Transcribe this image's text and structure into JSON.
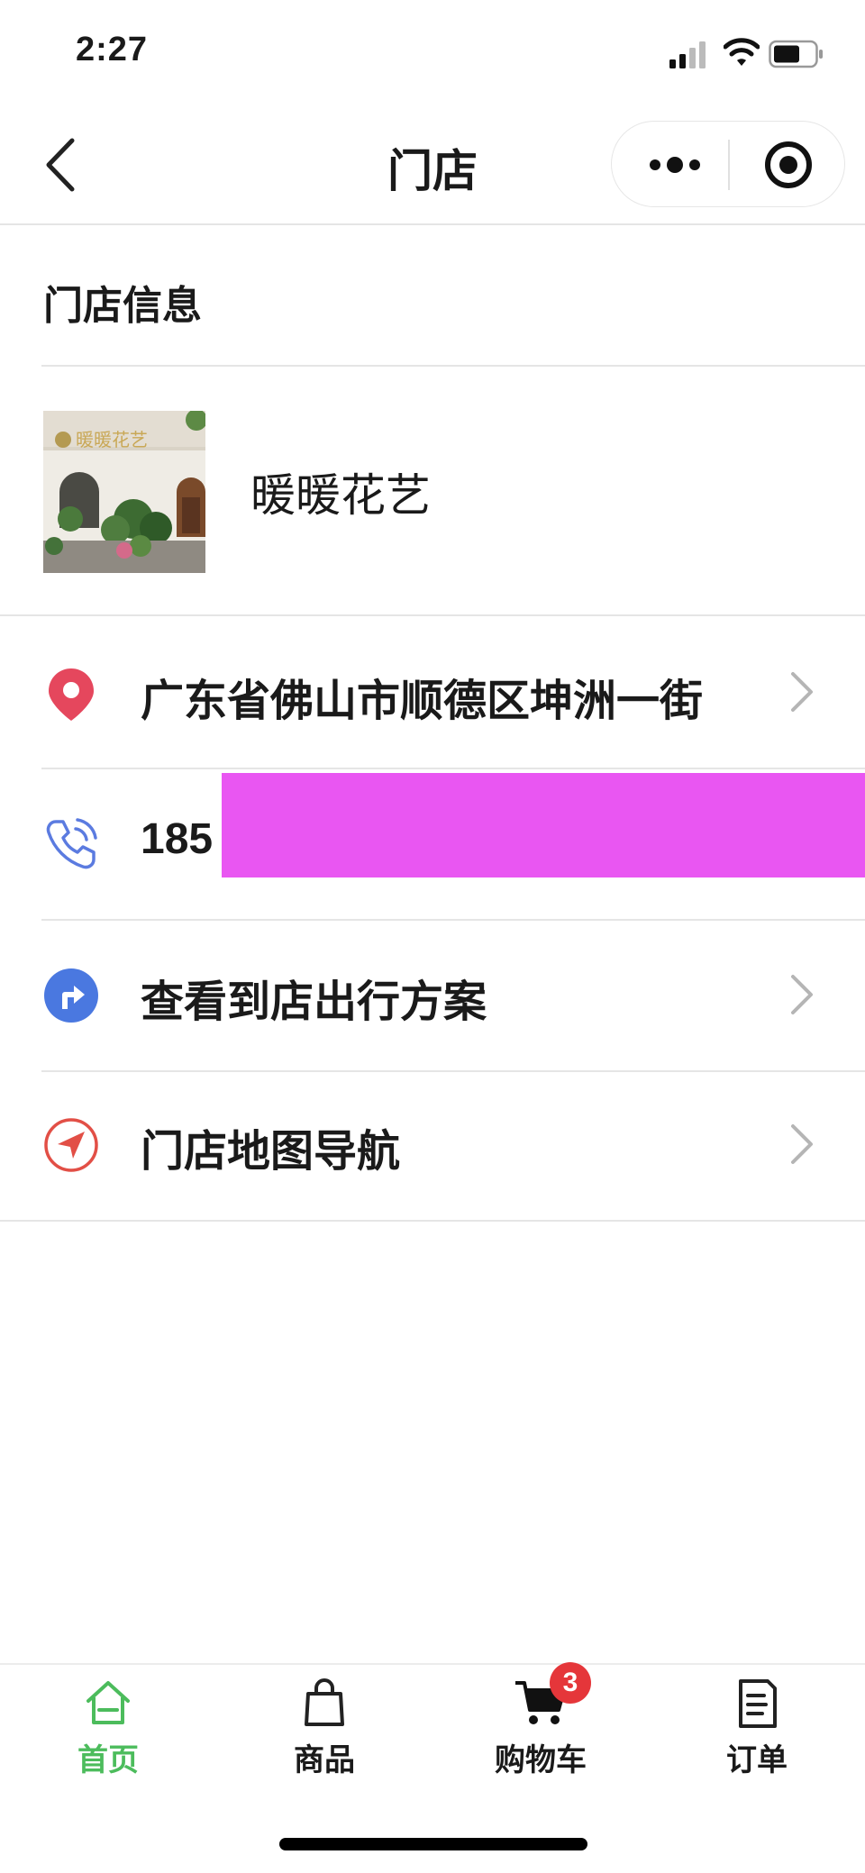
{
  "status_bar": {
    "time": "2:27"
  },
  "nav": {
    "title": "门店"
  },
  "section": {
    "title": "门店信息"
  },
  "store": {
    "name": "暖暖花艺",
    "sign_text": "暖暖花艺"
  },
  "rows": {
    "address": "广东省佛山市顺德区坤洲一街",
    "phone": "185",
    "route": "查看到店出行方案",
    "navigate": "门店地图导航"
  },
  "tabs": [
    {
      "label": "首页",
      "active": true
    },
    {
      "label": "商品",
      "active": false
    },
    {
      "label": "购物车",
      "active": false,
      "badge": "3"
    },
    {
      "label": "订单",
      "active": false
    }
  ],
  "colors": {
    "active_tab": "#4cbc5c",
    "badge": "#e5363a",
    "location_pin": "#e5475d",
    "phone_icon": "#5b7be0",
    "route_icon": "#4a78e0",
    "navigate_icon": "#e24f46",
    "redaction": "#e956f2"
  },
  "icons": [
    "signal-icon",
    "wifi-icon",
    "battery-icon",
    "back-icon",
    "more-icon",
    "close-target-icon",
    "location-pin-icon",
    "phone-icon",
    "route-icon",
    "navigation-icon",
    "chevron-right-icon",
    "home-icon",
    "bag-icon",
    "cart-icon",
    "order-icon"
  ]
}
